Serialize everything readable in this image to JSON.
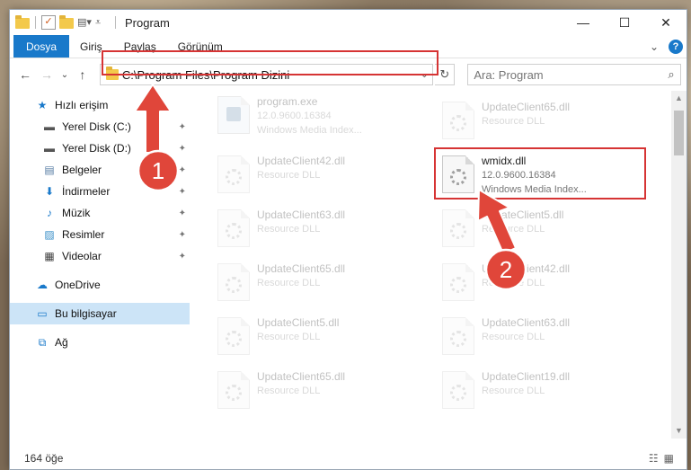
{
  "window": {
    "title": "Program",
    "controls": [
      "—",
      "☐",
      "✕"
    ]
  },
  "ribbon": {
    "tabs": [
      "Dosya",
      "Giriş",
      "Paylaş",
      "Görünüm"
    ],
    "expand": "⌄",
    "help": "?"
  },
  "nav": {
    "back": "←",
    "forward": "→",
    "recent": "⌄",
    "up": "↑",
    "address": "C:\\Program Files\\Program Dizini",
    "address_dropdown": "⌄",
    "refresh": "↻",
    "search_placeholder": "Ara: Program",
    "search_icon": "⌕"
  },
  "sidebar": {
    "items": [
      {
        "label": "Hızlı erişim",
        "icon": "star-icon",
        "glyph": "★",
        "color": "#1979ca",
        "pinned": false
      },
      {
        "label": "Yerel Disk (C:)",
        "icon": "drive-icon",
        "glyph": "▬",
        "color": "#555555",
        "pinned": true
      },
      {
        "label": "Yerel Disk (D:)",
        "icon": "drive-icon",
        "glyph": "▬",
        "color": "#555555",
        "pinned": true
      },
      {
        "label": "Belgeler",
        "icon": "documents-icon",
        "glyph": "▤",
        "color": "#5a7fa6",
        "pinned": true
      },
      {
        "label": "İndirmeler",
        "icon": "download-icon",
        "glyph": "⬇",
        "color": "#1979ca",
        "pinned": true
      },
      {
        "label": "Müzik",
        "icon": "music-icon",
        "glyph": "♪",
        "color": "#1979ca",
        "pinned": true
      },
      {
        "label": "Resimler",
        "icon": "pictures-icon",
        "glyph": "▨",
        "color": "#3a8fc8",
        "pinned": true
      },
      {
        "label": "Videolar",
        "icon": "videos-icon",
        "glyph": "▦",
        "color": "#444444",
        "pinned": true
      },
      {
        "label": "OneDrive",
        "icon": "cloud-icon",
        "glyph": "☁",
        "color": "#1979ca",
        "pinned": false
      },
      {
        "label": "Bu bilgisayar",
        "icon": "computer-icon",
        "glyph": "▭",
        "color": "#1979ca",
        "pinned": false,
        "selected": true
      },
      {
        "label": "Ağ",
        "icon": "network-icon",
        "glyph": "⧉",
        "color": "#1979ca",
        "pinned": false
      }
    ],
    "pin_glyph": "📌"
  },
  "files": [
    {
      "name": "program.exe",
      "line2": "12.0.9600.16384",
      "line3": "Windows Media Index...",
      "kind": "exe",
      "highlight": false
    },
    {
      "name": "UpdateClient65.dll",
      "line2": "Resource DLL",
      "line3": "",
      "kind": "dll",
      "highlight": false
    },
    {
      "name": "UpdateClient42.dll",
      "line2": "Resource DLL",
      "line3": "",
      "kind": "dll",
      "highlight": false
    },
    {
      "name": "wmidx.dll",
      "line2": "12.0.9600.16384",
      "line3": "Windows Media Index...",
      "kind": "dll",
      "highlight": true
    },
    {
      "name": "UpdateClient63.dll",
      "line2": "Resource DLL",
      "line3": "",
      "kind": "dll",
      "highlight": false
    },
    {
      "name": "UpdateClient5.dll",
      "line2": "Resource DLL",
      "line3": "",
      "kind": "dll",
      "highlight": false
    },
    {
      "name": "UpdateClient65.dll",
      "line2": "Resource DLL",
      "line3": "",
      "kind": "dll",
      "highlight": false
    },
    {
      "name": "UpdateClient42.dll",
      "line2": "Resource DLL",
      "line3": "",
      "kind": "dll",
      "highlight": false
    },
    {
      "name": "UpdateClient5.dll",
      "line2": "Resource DLL",
      "line3": "",
      "kind": "dll",
      "highlight": false
    },
    {
      "name": "UpdateClient63.dll",
      "line2": "Resource DLL",
      "line3": "",
      "kind": "dll",
      "highlight": false
    },
    {
      "name": "UpdateClient65.dll",
      "line2": "Resource DLL",
      "line3": "",
      "kind": "dll",
      "highlight": false
    },
    {
      "name": "UpdateClient19.dll",
      "line2": "Resource DLL",
      "line3": "",
      "kind": "dll",
      "highlight": false
    }
  ],
  "status": {
    "count": "164 öğe",
    "view_details": "☷",
    "view_tiles": "▦"
  },
  "annotations": {
    "step1": "1",
    "step2": "2",
    "color": "#e0463a"
  }
}
